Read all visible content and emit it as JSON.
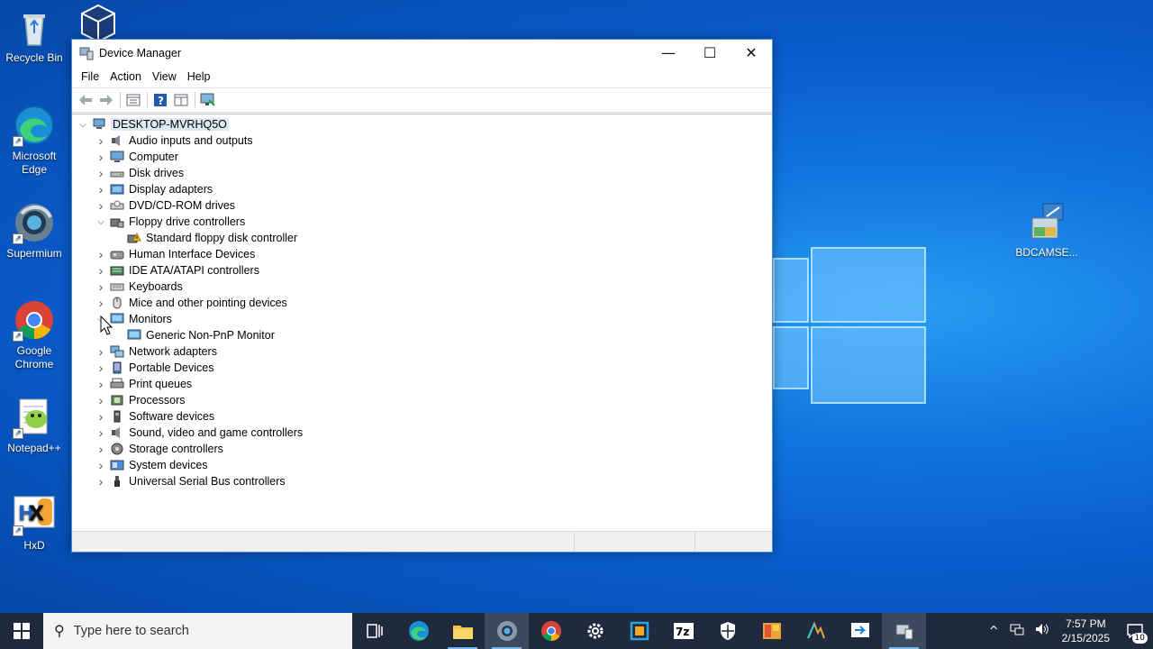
{
  "desktop": {
    "icons": [
      {
        "label": "Recycle Bin",
        "icon": "recycle-bin-icon"
      },
      {
        "label": "",
        "icon": "virtualbox-icon"
      },
      {
        "label": "Microsoft Edge",
        "icon": "edge-icon"
      },
      {
        "label": "Supermium",
        "icon": "supermium-icon"
      },
      {
        "label": "Google Chrome",
        "icon": "chrome-icon"
      },
      {
        "label": "Notepad++",
        "icon": "notepad-plus-plus-icon"
      },
      {
        "label": "HxD",
        "icon": "hxd-icon"
      },
      {
        "label": "BDCAMSE...",
        "icon": "bdcamsetup-icon"
      }
    ]
  },
  "window": {
    "title": "Device Manager",
    "controls": {
      "minimize": "—",
      "maximize": "☐",
      "close": "✕"
    },
    "menu": [
      "File",
      "Action",
      "View",
      "Help"
    ],
    "toolbar": [
      "back-icon",
      "forward-icon",
      "properties-icon",
      "help-icon",
      "show-hidden-icon",
      "scan-hardware-icon"
    ],
    "tree": {
      "root": "DESKTOP-MVRHQ5O",
      "items": [
        {
          "label": "Audio inputs and outputs",
          "expanded": false,
          "icon": "speaker-icon"
        },
        {
          "label": "Computer",
          "expanded": false,
          "icon": "computer-icon"
        },
        {
          "label": "Disk drives",
          "expanded": false,
          "icon": "disk-drive-icon"
        },
        {
          "label": "Display adapters",
          "expanded": false,
          "icon": "display-adapter-icon"
        },
        {
          "label": "DVD/CD-ROM drives",
          "expanded": false,
          "icon": "dvd-drive-icon"
        },
        {
          "label": "Floppy drive controllers",
          "expanded": true,
          "icon": "floppy-controller-icon",
          "children": [
            {
              "label": "Standard floppy disk controller",
              "icon": "floppy-warning-icon"
            }
          ]
        },
        {
          "label": "Human Interface Devices",
          "expanded": false,
          "icon": "hid-icon"
        },
        {
          "label": "IDE ATA/ATAPI controllers",
          "expanded": false,
          "icon": "ide-controller-icon"
        },
        {
          "label": "Keyboards",
          "expanded": false,
          "icon": "keyboard-icon"
        },
        {
          "label": "Mice and other pointing devices",
          "expanded": false,
          "icon": "mouse-icon"
        },
        {
          "label": "Monitors",
          "expanded": true,
          "icon": "monitor-icon",
          "children": [
            {
              "label": "Generic Non-PnP Monitor",
              "icon": "monitor-icon"
            }
          ]
        },
        {
          "label": "Network adapters",
          "expanded": false,
          "icon": "network-adapter-icon"
        },
        {
          "label": "Portable Devices",
          "expanded": false,
          "icon": "portable-device-icon"
        },
        {
          "label": "Print queues",
          "expanded": false,
          "icon": "printer-icon"
        },
        {
          "label": "Processors",
          "expanded": false,
          "icon": "processor-icon"
        },
        {
          "label": "Software devices",
          "expanded": false,
          "icon": "software-device-icon"
        },
        {
          "label": "Sound, video and game controllers",
          "expanded": false,
          "icon": "sound-controller-icon"
        },
        {
          "label": "Storage controllers",
          "expanded": false,
          "icon": "storage-controller-icon"
        },
        {
          "label": "System devices",
          "expanded": false,
          "icon": "system-device-icon"
        },
        {
          "label": "Universal Serial Bus controllers",
          "expanded": false,
          "icon": "usb-icon"
        }
      ]
    }
  },
  "taskbar": {
    "search_placeholder": "Type here to search",
    "apps": [
      "task-view-icon",
      "edge-icon",
      "file-explorer-icon",
      "supermium-icon",
      "chrome-icon",
      "settings-icon",
      "virtualbox-icon",
      "7zip-icon",
      "security-icon",
      "mspaint-icon",
      "inkscape-icon",
      "remote-desktop-icon",
      "device-manager-icon"
    ],
    "clock_time": "7:57 PM",
    "clock_date": "2/15/2025",
    "notification_count": "10"
  },
  "colors": {
    "accent": "#0078d7",
    "taskbar": "#1f2a3c",
    "selection": "#dde8f5"
  }
}
